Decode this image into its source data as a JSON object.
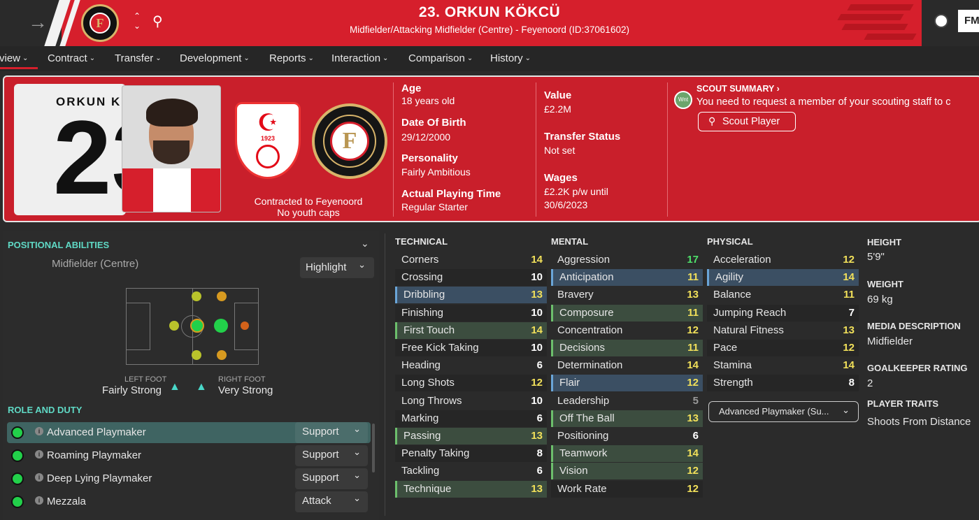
{
  "header": {
    "title": "23. ORKUN KÖKCÜ",
    "subtitle": "Midfielder/Attacking Midfielder (Centre) - Feyenoord (ID:37061602)",
    "club_badge_letter": "F",
    "fm_logo": "FM",
    "icons": [
      "back-arrow-icon",
      "club-badge-icon",
      "up-down-icon",
      "search-icon",
      "football-icon",
      "fm-logo-icon"
    ],
    "accent_color": "#d61f2c"
  },
  "tabs": [
    {
      "label": "rview"
    },
    {
      "label": "Contract"
    },
    {
      "label": "Transfer"
    },
    {
      "label": "Development"
    },
    {
      "label": "Reports"
    },
    {
      "label": "Interaction"
    },
    {
      "label": "Comparison"
    },
    {
      "label": "History"
    }
  ],
  "card": {
    "shirt_name": "ORKUN KÖ",
    "shirt_number": "23",
    "nation_year": "1923",
    "club_badge_letter": "F",
    "contracted": "Contracted to Feyenoord",
    "youth_caps": "No youth caps",
    "age_label": "Age",
    "age_value": "18 years old",
    "dob_label": "Date Of Birth",
    "dob_value": "29/12/2000",
    "personality_label": "Personality",
    "personality_value": "Fairly Ambitious",
    "playing_time_label": "Actual Playing Time",
    "playing_time_value": "Regular Starter",
    "value_label": "Value",
    "value_value": "£2.2M",
    "transfer_label": "Transfer Status",
    "transfer_value": "Not set",
    "wages_label": "Wages",
    "wages_value_1": "£2.2K p/w until",
    "wages_value_2": "30/6/2023",
    "scout_badge": "Wnt",
    "scout_title": "SCOUT SUMMARY",
    "scout_text": "You need to request a member of your scouting staff to c",
    "scout_button": "Scout Player"
  },
  "positional": {
    "title": "POSITIONAL ABILITIES",
    "position": "Midfielder (Centre)",
    "highlight_button": "Highlight",
    "left_foot_label": "LEFT FOOT",
    "left_foot_value": "Fairly Strong",
    "right_foot_label": "RIGHT FOOT",
    "right_foot_value": "Very Strong"
  },
  "roles": {
    "title": "ROLE AND DUTY",
    "items": [
      {
        "name": "Advanced Playmaker",
        "duty": "Support"
      },
      {
        "name": "Roaming Playmaker",
        "duty": "Support"
      },
      {
        "name": "Deep Lying Playmaker",
        "duty": "Support"
      },
      {
        "name": "Mezzala",
        "duty": "Attack"
      }
    ]
  },
  "attributes": {
    "technical_title": "TECHNICAL",
    "mental_title": "MENTAL",
    "physical_title": "PHYSICAL",
    "technical": [
      {
        "name": "Corners",
        "value": "14"
      },
      {
        "name": "Crossing",
        "value": "10"
      },
      {
        "name": "Dribbling",
        "value": "13"
      },
      {
        "name": "Finishing",
        "value": "10"
      },
      {
        "name": "First Touch",
        "value": "14"
      },
      {
        "name": "Free Kick Taking",
        "value": "10"
      },
      {
        "name": "Heading",
        "value": "6"
      },
      {
        "name": "Long Shots",
        "value": "12"
      },
      {
        "name": "Long Throws",
        "value": "10"
      },
      {
        "name": "Marking",
        "value": "6"
      },
      {
        "name": "Passing",
        "value": "13"
      },
      {
        "name": "Penalty Taking",
        "value": "8"
      },
      {
        "name": "Tackling",
        "value": "6"
      },
      {
        "name": "Technique",
        "value": "13"
      }
    ],
    "mental": [
      {
        "name": "Aggression",
        "value": "17"
      },
      {
        "name": "Anticipation",
        "value": "11"
      },
      {
        "name": "Bravery",
        "value": "13"
      },
      {
        "name": "Composure",
        "value": "11"
      },
      {
        "name": "Concentration",
        "value": "12"
      },
      {
        "name": "Decisions",
        "value": "11"
      },
      {
        "name": "Determination",
        "value": "14"
      },
      {
        "name": "Flair",
        "value": "12"
      },
      {
        "name": "Leadership",
        "value": "5"
      },
      {
        "name": "Off The Ball",
        "value": "13"
      },
      {
        "name": "Positioning",
        "value": "6"
      },
      {
        "name": "Teamwork",
        "value": "14"
      },
      {
        "name": "Vision",
        "value": "12"
      },
      {
        "name": "Work Rate",
        "value": "12"
      }
    ],
    "physical": [
      {
        "name": "Acceleration",
        "value": "12"
      },
      {
        "name": "Agility",
        "value": "14"
      },
      {
        "name": "Balance",
        "value": "11"
      },
      {
        "name": "Jumping Reach",
        "value": "7"
      },
      {
        "name": "Natural Fitness",
        "value": "13"
      },
      {
        "name": "Pace",
        "value": "12"
      },
      {
        "name": "Stamina",
        "value": "14"
      },
      {
        "name": "Strength",
        "value": "8"
      }
    ],
    "role_dropdown": "Advanced Playmaker (Su..."
  },
  "info": {
    "height_label": "HEIGHT",
    "height_value": "5'9\"",
    "weight_label": "WEIGHT",
    "weight_value": "69 kg",
    "media_label": "MEDIA DESCRIPTION",
    "media_value": "Midfielder",
    "gk_label": "GOALKEEPER RATING",
    "gk_value": "2",
    "traits_label": "PLAYER TRAITS",
    "traits_value": "Shoots From Distance"
  }
}
